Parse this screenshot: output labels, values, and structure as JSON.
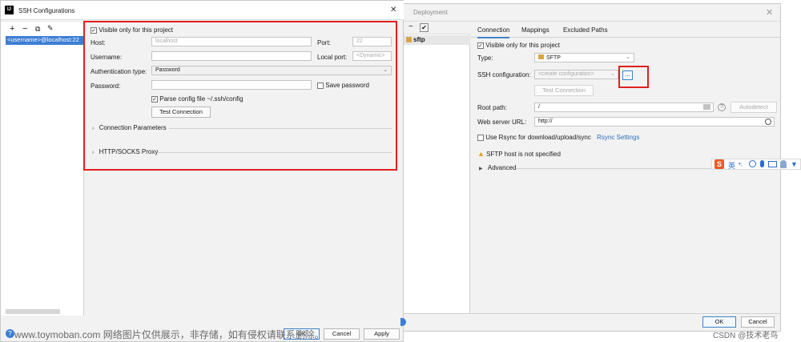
{
  "ssh_dialog": {
    "title": "SSH Configurations",
    "app_icon_text": "IJ",
    "close_glyph": "✕",
    "toolbar": {
      "add": "+",
      "remove": "−",
      "copy": "⧉",
      "edit": "✎"
    },
    "list_item": "<username>@localhost:22",
    "visible_only_label": "Visible only for this project",
    "host_label": "Host:",
    "host_placeholder": "localhost",
    "port_label": "Port:",
    "port_placeholder": "22",
    "username_label": "Username:",
    "local_port_label": "Local port:",
    "local_port_placeholder": "<Dynamic>",
    "auth_type_label": "Authentication type:",
    "auth_type_value": "Password",
    "password_label": "Password:",
    "save_password_label": "Save password",
    "parse_config_label": "Parse config file ~/.ssh/config",
    "test_connection": "Test Connection",
    "connection_parameters": "Connection Parameters",
    "proxy": "HTTP/SOCKS Proxy",
    "ok": "OK",
    "cancel": "Cancel",
    "apply": "Apply",
    "help": "?"
  },
  "deployment_dialog": {
    "title": "Deployment",
    "close_glyph": "✕",
    "server_item": "sftp",
    "tabs": [
      "Connection",
      "Mappings",
      "Excluded Paths"
    ],
    "visible_only_label": "Visible only for this project",
    "type_label": "Type:",
    "type_value": "SFTP",
    "ssh_config_label": "SSH configuration:",
    "ssh_config_value": "<create configuration>",
    "browse_button": "...",
    "test_connection": "Test Connection",
    "root_path_label": "Root path:",
    "root_path_value": "/",
    "autodetect": "Autodetect",
    "web_url_label": "Web server URL:",
    "web_url_value": "http://",
    "rsync_label": "Use Rsync for download/upload/sync",
    "rsync_settings": "Rsync Settings",
    "warning": "SFTP host is not specified",
    "advanced": "Advanced",
    "ok": "OK",
    "cancel": "Cancel"
  },
  "ime_bar": {
    "logo": "S",
    "lang": "英"
  },
  "watermark": {
    "left": "www.toymoban.com 网络图片仅供展示，非存储，如有侵权请联系删除。",
    "right": "CSDN @技术老鸟"
  },
  "colors": {
    "accent": "#3d7ed5",
    "highlight": "#e02020",
    "link": "#2f6fba"
  }
}
